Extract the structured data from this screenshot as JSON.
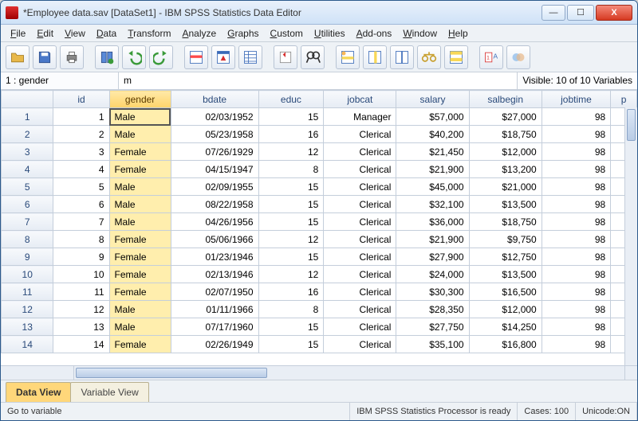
{
  "window": {
    "title": "*Employee data.sav [DataSet1] - IBM SPSS Statistics Data Editor"
  },
  "menus": [
    "File",
    "Edit",
    "View",
    "Data",
    "Transform",
    "Analyze",
    "Graphs",
    "Custom",
    "Utilities",
    "Add-ons",
    "Window",
    "Help"
  ],
  "toolbar_icons": [
    "open",
    "save",
    "print",
    "|",
    "recall",
    "undo",
    "redo",
    "|",
    "goto-case",
    "goto-var",
    "variables",
    "|",
    "run",
    "find",
    "|",
    "insert-case",
    "insert-var",
    "split",
    "weight",
    "select",
    "|",
    "value-labels",
    "use-sets"
  ],
  "cellbar": {
    "ref": "1 : gender",
    "value": "m",
    "visible": "Visible: 10 of 10 Variables"
  },
  "columns": [
    "id",
    "gender",
    "bdate",
    "educ",
    "jobcat",
    "salary",
    "salbegin",
    "jobtime",
    "p"
  ],
  "selected_column_index": 1,
  "selected_cell": {
    "row": 0,
    "col": 1
  },
  "rows": [
    {
      "n": 1,
      "id": 1,
      "gender": "Male",
      "bdate": "02/03/1952",
      "educ": 15,
      "jobcat": "Manager",
      "salary": "$57,000",
      "salbegin": "$27,000",
      "jobtime": 98
    },
    {
      "n": 2,
      "id": 2,
      "gender": "Male",
      "bdate": "05/23/1958",
      "educ": 16,
      "jobcat": "Clerical",
      "salary": "$40,200",
      "salbegin": "$18,750",
      "jobtime": 98
    },
    {
      "n": 3,
      "id": 3,
      "gender": "Female",
      "bdate": "07/26/1929",
      "educ": 12,
      "jobcat": "Clerical",
      "salary": "$21,450",
      "salbegin": "$12,000",
      "jobtime": 98
    },
    {
      "n": 4,
      "id": 4,
      "gender": "Female",
      "bdate": "04/15/1947",
      "educ": 8,
      "jobcat": "Clerical",
      "salary": "$21,900",
      "salbegin": "$13,200",
      "jobtime": 98
    },
    {
      "n": 5,
      "id": 5,
      "gender": "Male",
      "bdate": "02/09/1955",
      "educ": 15,
      "jobcat": "Clerical",
      "salary": "$45,000",
      "salbegin": "$21,000",
      "jobtime": 98
    },
    {
      "n": 6,
      "id": 6,
      "gender": "Male",
      "bdate": "08/22/1958",
      "educ": 15,
      "jobcat": "Clerical",
      "salary": "$32,100",
      "salbegin": "$13,500",
      "jobtime": 98
    },
    {
      "n": 7,
      "id": 7,
      "gender": "Male",
      "bdate": "04/26/1956",
      "educ": 15,
      "jobcat": "Clerical",
      "salary": "$36,000",
      "salbegin": "$18,750",
      "jobtime": 98
    },
    {
      "n": 8,
      "id": 8,
      "gender": "Female",
      "bdate": "05/06/1966",
      "educ": 12,
      "jobcat": "Clerical",
      "salary": "$21,900",
      "salbegin": "$9,750",
      "jobtime": 98
    },
    {
      "n": 9,
      "id": 9,
      "gender": "Female",
      "bdate": "01/23/1946",
      "educ": 15,
      "jobcat": "Clerical",
      "salary": "$27,900",
      "salbegin": "$12,750",
      "jobtime": 98
    },
    {
      "n": 10,
      "id": 10,
      "gender": "Female",
      "bdate": "02/13/1946",
      "educ": 12,
      "jobcat": "Clerical",
      "salary": "$24,000",
      "salbegin": "$13,500",
      "jobtime": 98
    },
    {
      "n": 11,
      "id": 11,
      "gender": "Female",
      "bdate": "02/07/1950",
      "educ": 16,
      "jobcat": "Clerical",
      "salary": "$30,300",
      "salbegin": "$16,500",
      "jobtime": 98
    },
    {
      "n": 12,
      "id": 12,
      "gender": "Male",
      "bdate": "01/11/1966",
      "educ": 8,
      "jobcat": "Clerical",
      "salary": "$28,350",
      "salbegin": "$12,000",
      "jobtime": 98
    },
    {
      "n": 13,
      "id": 13,
      "gender": "Male",
      "bdate": "07/17/1960",
      "educ": 15,
      "jobcat": "Clerical",
      "salary": "$27,750",
      "salbegin": "$14,250",
      "jobtime": 98
    },
    {
      "n": 14,
      "id": 14,
      "gender": "Female",
      "bdate": "02/26/1949",
      "educ": 15,
      "jobcat": "Clerical",
      "salary": "$35,100",
      "salbegin": "$16,800",
      "jobtime": 98
    }
  ],
  "tabs": {
    "data": "Data View",
    "variable": "Variable View"
  },
  "status": {
    "left": "Go to variable",
    "processor": "IBM SPSS Statistics Processor is ready",
    "cases": "Cases: 100",
    "unicode": "Unicode:ON"
  }
}
